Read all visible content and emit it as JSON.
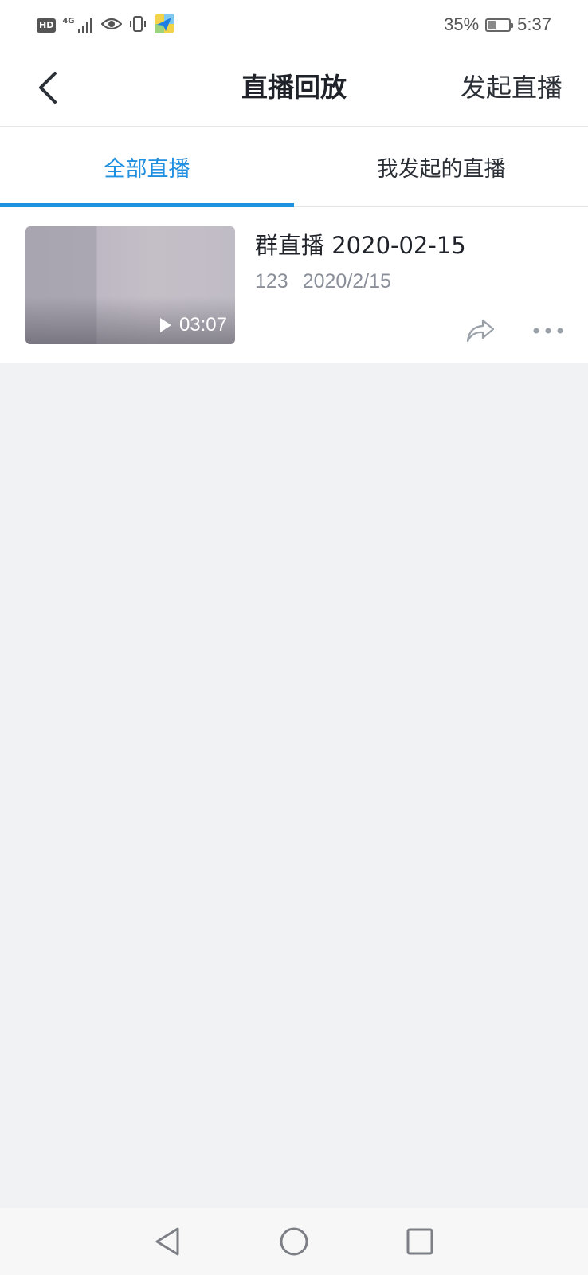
{
  "status_bar": {
    "network_badge": "HD",
    "network_type": "4G",
    "battery_percent": "35%",
    "battery_level": 0.35,
    "time": "5:37"
  },
  "header": {
    "title": "直播回放",
    "action_label": "发起直播",
    "back_icon": "chevron-left-icon"
  },
  "tabs": [
    {
      "label": "全部直播",
      "active": true
    },
    {
      "label": "我发起的直播",
      "active": false
    }
  ],
  "items": [
    {
      "title": "群直播 2020-02-15",
      "author": "123",
      "date": "2020/2/15",
      "duration": "03:07"
    }
  ],
  "nav_bar": {
    "back_icon": "triangle-back-icon",
    "home_icon": "circle-home-icon",
    "recents_icon": "square-recents-icon"
  },
  "colors": {
    "accent": "#1f8fe0",
    "background": "#f1f2f4",
    "text_primary": "#1f2329",
    "text_secondary": "#8a8f99"
  }
}
